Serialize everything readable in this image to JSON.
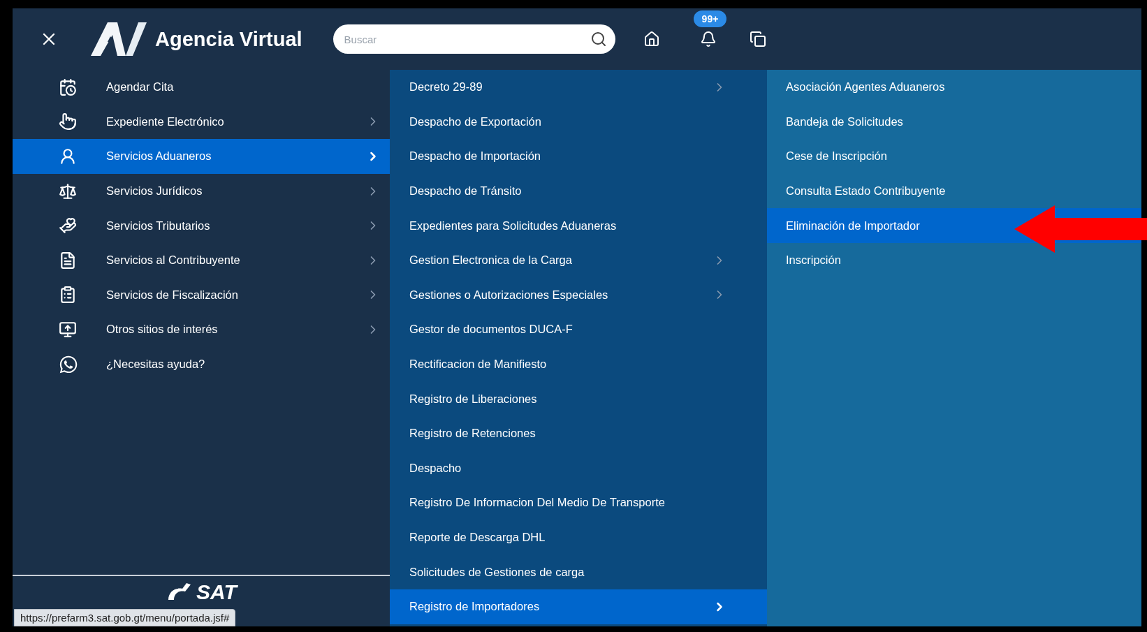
{
  "header": {
    "logo_text": "Agencia Virtual",
    "search": {
      "placeholder": "Buscar"
    },
    "notification_count": "99+"
  },
  "main_menu": [
    {
      "label": "Agendar Cita",
      "has_submenu": false,
      "selected": false
    },
    {
      "label": "Expediente Electrónico",
      "has_submenu": true,
      "selected": false
    },
    {
      "label": "Servicios Aduaneros",
      "has_submenu": true,
      "selected": true
    },
    {
      "label": "Servicios Jurídicos",
      "has_submenu": true,
      "selected": false
    },
    {
      "label": "Servicios Tributarios",
      "has_submenu": true,
      "selected": false
    },
    {
      "label": "Servicios al Contribuyente",
      "has_submenu": true,
      "selected": false
    },
    {
      "label": "Servicios de Fiscalización",
      "has_submenu": true,
      "selected": false
    },
    {
      "label": "Otros sitios de interés",
      "has_submenu": true,
      "selected": false
    },
    {
      "label": "¿Necesitas ayuda?",
      "has_submenu": false,
      "selected": false
    }
  ],
  "footer_logo_text": "SAT",
  "submenu": [
    {
      "label": "Decreto 29-89",
      "has_submenu": true,
      "selected": false
    },
    {
      "label": "Despacho de Exportación",
      "has_submenu": false,
      "selected": false
    },
    {
      "label": "Despacho de Importación",
      "has_submenu": false,
      "selected": false
    },
    {
      "label": "Despacho de Tránsito",
      "has_submenu": false,
      "selected": false
    },
    {
      "label": "Expedientes para Solicitudes Aduaneras",
      "has_submenu": false,
      "selected": false
    },
    {
      "label": "Gestion Electronica de la Carga",
      "has_submenu": true,
      "selected": false
    },
    {
      "label": "Gestiones o Autorizaciones Especiales",
      "has_submenu": true,
      "selected": false
    },
    {
      "label": "Gestor de documentos DUCA-F",
      "has_submenu": false,
      "selected": false
    },
    {
      "label": "Rectificacion de Manifiesto",
      "has_submenu": false,
      "selected": false
    },
    {
      "label": "Registro de Liberaciones",
      "has_submenu": false,
      "selected": false
    },
    {
      "label": "Registro de Retenciones",
      "has_submenu": false,
      "selected": false
    },
    {
      "label": "Despacho",
      "has_submenu": false,
      "selected": false
    },
    {
      "label": "Registro De Informacion Del Medio De Transporte",
      "has_submenu": false,
      "selected": false
    },
    {
      "label": "Reporte de Descarga DHL",
      "has_submenu": false,
      "selected": false
    },
    {
      "label": "Solicitudes de Gestiones de carga",
      "has_submenu": false,
      "selected": false
    },
    {
      "label": "Registro de Importadores",
      "has_submenu": true,
      "selected": true
    }
  ],
  "sub_submenu": [
    {
      "label": "Asociación Agentes Aduaneros",
      "selected": false
    },
    {
      "label": "Bandeja de Solicitudes",
      "selected": false
    },
    {
      "label": "Cese de Inscripción",
      "selected": false
    },
    {
      "label": "Consulta Estado Contribuyente",
      "selected": false
    },
    {
      "label": "Eliminación de Importador",
      "selected": true
    },
    {
      "label": "Inscripción",
      "selected": false
    }
  ],
  "status_url": "https://prefarm3.sat.gob.gt/menu/portada.jsf#"
}
